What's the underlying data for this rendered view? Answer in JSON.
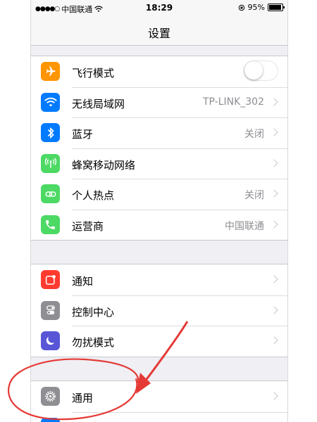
{
  "status_bar": {
    "signal": "●●●●○",
    "carrier": "中国联通",
    "time": "18:29",
    "battery": "95%",
    "battery_level": 0.95
  },
  "nav": {
    "title": "设置"
  },
  "groups": [
    {
      "rows": [
        {
          "label": "飞行模式",
          "value": "",
          "icon": "airplane-icon",
          "color": "#ff9500",
          "accessory": "toggle",
          "toggle_on": false
        },
        {
          "label": "无线局域网",
          "value": "TP-LINK_302",
          "icon": "wifi-icon",
          "color": "#007aff",
          "accessory": "chevron"
        },
        {
          "label": "蓝牙",
          "value": "关闭",
          "icon": "bluetooth-icon",
          "color": "#007aff",
          "accessory": "chevron"
        },
        {
          "label": "蜂窝移动网络",
          "value": "",
          "icon": "cellular-icon",
          "color": "#4cd964",
          "accessory": "chevron"
        },
        {
          "label": "个人热点",
          "value": "关闭",
          "icon": "hotspot-icon",
          "color": "#4cd964",
          "accessory": "chevron"
        },
        {
          "label": "运营商",
          "value": "中国联通",
          "icon": "phone-icon",
          "color": "#4cd964",
          "accessory": "chevron"
        }
      ]
    },
    {
      "rows": [
        {
          "label": "通知",
          "value": "",
          "icon": "notifications-icon",
          "color": "#ff3b30",
          "accessory": "chevron"
        },
        {
          "label": "控制中心",
          "value": "",
          "icon": "control-center-icon",
          "color": "#8e8e93",
          "accessory": "chevron"
        },
        {
          "label": "勿扰模式",
          "value": "",
          "icon": "moon-icon",
          "color": "#5856d6",
          "accessory": "chevron"
        }
      ]
    },
    {
      "rows": [
        {
          "label": "通用",
          "value": "",
          "icon": "gear-icon",
          "color": "#8e8e93",
          "accessory": "chevron"
        }
      ]
    }
  ],
  "annotation": {
    "color": "#e53935"
  }
}
